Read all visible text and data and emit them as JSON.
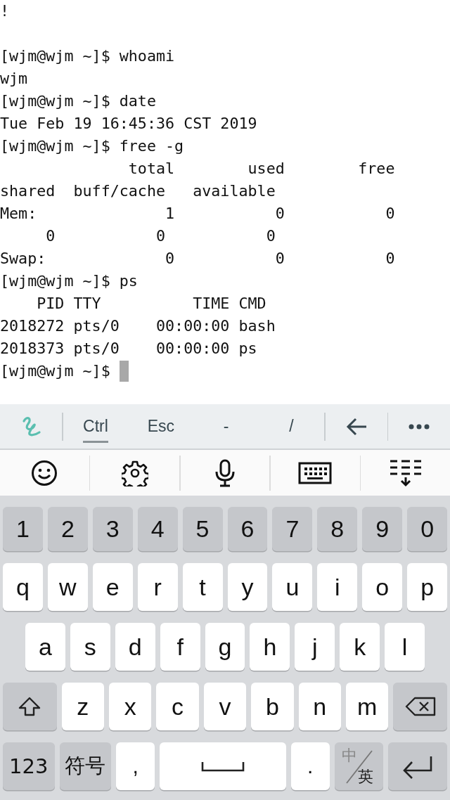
{
  "terminal": {
    "blocks": [
      {
        "lines": [
          "!"
        ]
      },
      {
        "lines": [
          "[wjm@wjm ~]$ whoami",
          "wjm",
          "[wjm@wjm ~]$ date",
          "Tue Feb 19 16:45:36 CST 2019",
          "[wjm@wjm ~]$ free -g",
          "              total        used        free",
          "shared  buff/cache   available",
          "Mem:              1           0           0",
          "     0           0           0",
          "Swap:             0           0           0",
          "[wjm@wjm ~]$ ps",
          "    PID TTY          TIME CMD",
          "2018272 pts/0    00:00:00 bash",
          "2018373 pts/0    00:00:00 ps"
        ]
      }
    ],
    "prompt": "[wjm@wjm ~]$ ",
    "cursor": true
  },
  "extra_keys": [
    {
      "label": "Ctrl",
      "selected": true
    },
    {
      "label": "Esc",
      "selected": false
    },
    {
      "label": "-",
      "selected": false
    },
    {
      "label": "/",
      "selected": false
    }
  ],
  "keyboard": {
    "rows": [
      [
        {
          "kind": "number",
          "label": "1"
        },
        {
          "kind": "number",
          "label": "2"
        },
        {
          "kind": "number",
          "label": "3"
        },
        {
          "kind": "number",
          "label": "4"
        },
        {
          "kind": "number",
          "label": "5"
        },
        {
          "kind": "number",
          "label": "6"
        },
        {
          "kind": "number",
          "label": "7"
        },
        {
          "kind": "number",
          "label": "8"
        },
        {
          "kind": "number",
          "label": "9"
        },
        {
          "kind": "number",
          "label": "0"
        }
      ],
      [
        {
          "kind": "letter",
          "label": "q"
        },
        {
          "kind": "letter",
          "label": "w"
        },
        {
          "kind": "letter",
          "label": "e"
        },
        {
          "kind": "letter",
          "label": "r"
        },
        {
          "kind": "letter",
          "label": "t"
        },
        {
          "kind": "letter",
          "label": "y"
        },
        {
          "kind": "letter",
          "label": "u"
        },
        {
          "kind": "letter",
          "label": "i"
        },
        {
          "kind": "letter",
          "label": "o"
        },
        {
          "kind": "letter",
          "label": "p"
        }
      ],
      [
        {
          "kind": "letter",
          "label": "a"
        },
        {
          "kind": "letter",
          "label": "s"
        },
        {
          "kind": "letter",
          "label": "d"
        },
        {
          "kind": "letter",
          "label": "f"
        },
        {
          "kind": "letter",
          "label": "g"
        },
        {
          "kind": "letter",
          "label": "h"
        },
        {
          "kind": "letter",
          "label": "j"
        },
        {
          "kind": "letter",
          "label": "k"
        },
        {
          "kind": "letter",
          "label": "l"
        }
      ],
      [
        {
          "kind": "shift"
        },
        {
          "kind": "letter",
          "label": "z"
        },
        {
          "kind": "letter",
          "label": "x"
        },
        {
          "kind": "letter",
          "label": "c"
        },
        {
          "kind": "letter",
          "label": "v"
        },
        {
          "kind": "letter",
          "label": "b"
        },
        {
          "kind": "letter",
          "label": "n"
        },
        {
          "kind": "letter",
          "label": "m"
        },
        {
          "kind": "backspace"
        }
      ],
      [
        {
          "kind": "mode",
          "label": "123"
        },
        {
          "kind": "mode",
          "label": "符号"
        },
        {
          "kind": "punct",
          "label": ","
        },
        {
          "kind": "space"
        },
        {
          "kind": "punct",
          "label": "."
        },
        {
          "kind": "lang",
          "top": "中",
          "bottom": "英"
        },
        {
          "kind": "enter"
        }
      ]
    ]
  }
}
